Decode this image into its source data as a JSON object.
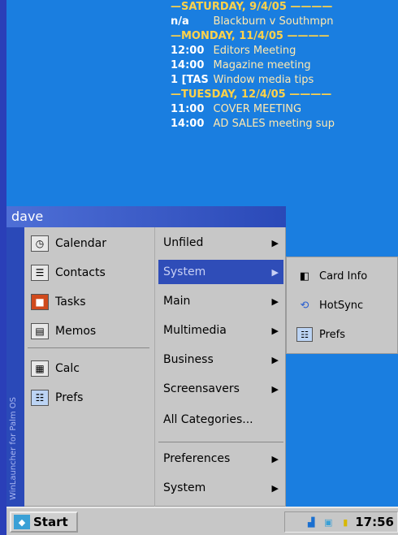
{
  "agenda": {
    "days": [
      {
        "header": "—SATURDAY, 9/4/05 ————",
        "events": [
          {
            "time": "n/a",
            "title": "Blackburn v Southmpn"
          }
        ]
      },
      {
        "header": "—MONDAY, 11/4/05 ————",
        "events": [
          {
            "time": "12:00",
            "title": "Editors Meeting"
          },
          {
            "time": "14:00",
            "title": "Magazine meeting"
          },
          {
            "time": "1 [TAS",
            "title": "Window media tips"
          }
        ]
      },
      {
        "header": "—TUESDAY, 12/4/05 ————",
        "events": [
          {
            "time": "11:00",
            "title": "COVER MEETING"
          },
          {
            "time": "14:00",
            "title": "AD SALES meeting sup"
          }
        ]
      }
    ]
  },
  "launcher": {
    "title": "dave",
    "sidebar_text": "WinLauncher for Palm OS",
    "apps": [
      {
        "label": "Calendar",
        "icon": "calendar-icon"
      },
      {
        "label": "Contacts",
        "icon": "contacts-icon"
      },
      {
        "label": "Tasks",
        "icon": "tasks-icon"
      },
      {
        "label": "Memos",
        "icon": "memos-icon"
      },
      {
        "label": "Calc",
        "icon": "calculator-icon"
      },
      {
        "label": "Prefs",
        "icon": "prefs-icon"
      }
    ],
    "categories": [
      {
        "label": "Unfiled",
        "has_sub": true,
        "selected": false
      },
      {
        "label": "System",
        "has_sub": true,
        "selected": true
      },
      {
        "label": "Main",
        "has_sub": true,
        "selected": false
      },
      {
        "label": "Multimedia",
        "has_sub": true,
        "selected": false
      },
      {
        "label": "Business",
        "has_sub": true,
        "selected": false
      },
      {
        "label": "Screensavers",
        "has_sub": true,
        "selected": false
      },
      {
        "label": "All Categories...",
        "has_sub": false,
        "selected": false
      },
      {
        "label": "Preferences",
        "has_sub": true,
        "selected": false
      },
      {
        "label": "System",
        "has_sub": true,
        "selected": false
      }
    ],
    "submenu": [
      {
        "label": "Card Info",
        "icon": "card-info-icon"
      },
      {
        "label": "HotSync",
        "icon": "hotsync-icon"
      },
      {
        "label": "Prefs",
        "icon": "prefs-icon"
      }
    ]
  },
  "taskbar": {
    "start_label": "Start",
    "clock": "17:56"
  }
}
